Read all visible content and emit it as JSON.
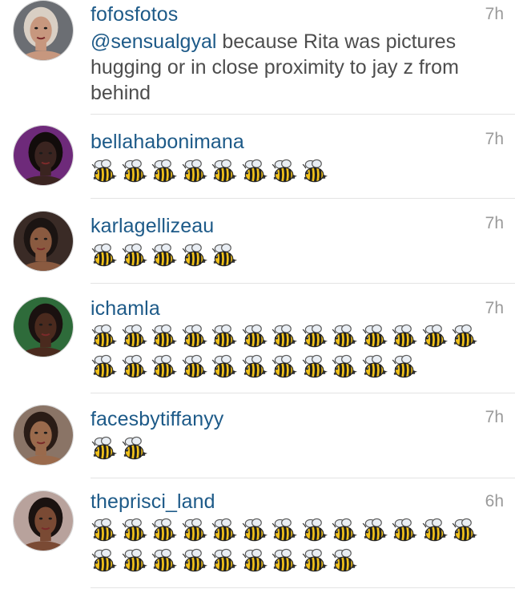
{
  "comments": [
    {
      "username": "fofosfotos",
      "time": "7h",
      "mention": "@sensualgyal",
      "text": " because Rita was pictures hugging or in close proximity to jay z from behind",
      "bees": 0,
      "avatar": {
        "skin": "#c7977e",
        "hair": "#d9cfc4",
        "bg": "#6b6e73"
      }
    },
    {
      "username": "bellahabonimana",
      "time": "7h",
      "mention": "",
      "text": "",
      "bees": 8,
      "avatar": {
        "skin": "#3a2420",
        "hair": "#120c0b",
        "bg": "#6e2a7a"
      }
    },
    {
      "username": "karlagellizeau",
      "time": "7h",
      "mention": "",
      "text": "",
      "bees": 5,
      "avatar": {
        "skin": "#8a5a40",
        "hair": "#1b1412",
        "bg": "#3a2b26"
      }
    },
    {
      "username": "ichamla",
      "time": "7h",
      "mention": "",
      "text": "",
      "bees": 24,
      "avatar": {
        "skin": "#4a2a1e",
        "hair": "#1a1110",
        "bg": "#2e6b3a"
      }
    },
    {
      "username": "facesbytiffanyy",
      "time": "7h",
      "mention": "",
      "text": "",
      "bees": 2,
      "avatar": {
        "skin": "#9a6a4c",
        "hair": "#2a1c16",
        "bg": "#8a7466"
      }
    },
    {
      "username": "theprisci_land",
      "time": "6h",
      "mention": "",
      "text": "",
      "bees": 22,
      "avatar": {
        "skin": "#7a4a34",
        "hair": "#1a1210",
        "bg": "#b8a29c"
      }
    }
  ]
}
